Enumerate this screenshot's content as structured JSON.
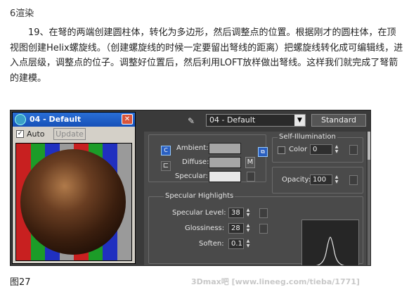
{
  "heading": "6渲染",
  "paragraph": "19、在弩的两端创建圆柱体，转化为多边形，然后调整点的位置。根据刚才的圆柱体，在顶视图创建Helix螺旋线。（创建螺旋线的时候一定要留出弩线的距离）把螺旋线转化成可编辑线，进入点层级，调整点的位子。调整好位置后，然后利用LOFT放样做出弩线。这样我们就完成了弩箭的建模。",
  "caption": "图27",
  "watermark": "3Dmax吧 [www.lineeg.com/tieba/1771]",
  "material_window": {
    "title": "04 - Default",
    "auto_label": "Auto",
    "auto_checked": "✓",
    "update_label": "Update",
    "close_glyph": "✕"
  },
  "editor": {
    "material_name": "04 - Default",
    "dropdown_glyph": "▼",
    "type_button": "Standard",
    "ambient_label": "Ambient:",
    "diffuse_label": "Diffuse:",
    "specular_label": "Specular:",
    "map_m_label": "M",
    "self_illumination": {
      "group_label": "Self-Illumination",
      "color_label": "Color",
      "value": "0"
    },
    "opacity_label": "Opacity:",
    "opacity_value": "100",
    "specular_highlights": {
      "group_label": "Specular Highlights",
      "level_label": "Specular Level:",
      "level_value": "38",
      "glossiness_label": "Glossiness:",
      "glossiness_value": "28",
      "soften_label": "Soften:",
      "soften_value": "0.1"
    },
    "colors": {
      "ambient": "#a6a6a6",
      "diffuse": "#a6a6a6",
      "specular": "#e8e8e8"
    }
  }
}
